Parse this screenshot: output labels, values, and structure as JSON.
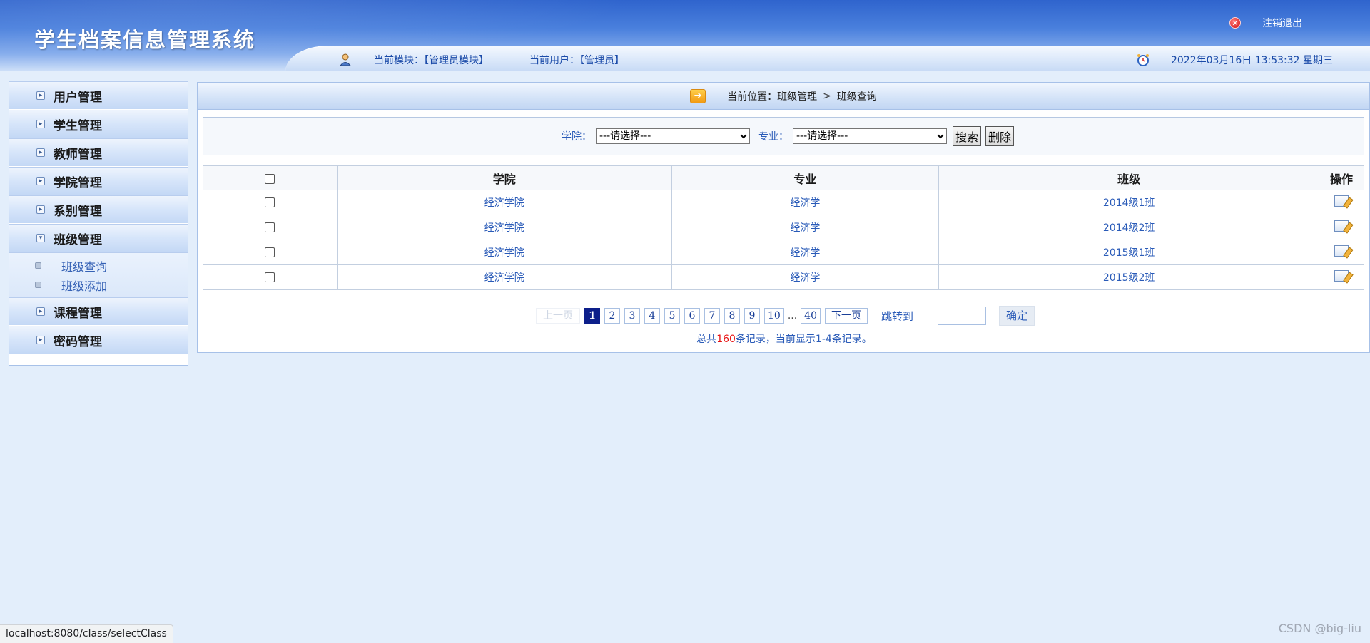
{
  "header": {
    "app_title": "学生档案信息管理系统",
    "logout_label": "注销退出",
    "current_module": "当前模块：【管理员模块】",
    "current_user": "当前用户：【管理员】",
    "datetime": "2022年03月16日 13:53:32 星期三"
  },
  "sidebar": {
    "items": [
      {
        "label": "用户管理"
      },
      {
        "label": "学生管理"
      },
      {
        "label": "教师管理"
      },
      {
        "label": "学院管理"
      },
      {
        "label": "系别管理"
      },
      {
        "label": "班级管理"
      },
      {
        "label": "课程管理"
      },
      {
        "label": "密码管理"
      }
    ],
    "sub_items": [
      {
        "label": "班级查询"
      },
      {
        "label": "班级添加"
      }
    ]
  },
  "breadcrumb": {
    "prefix": "当前位置：班级管理",
    "sep": ">",
    "current": "班级查询"
  },
  "filter": {
    "college_label": "学院：",
    "college_value": "---请选择---",
    "major_label": "专业：",
    "major_value": "---请选择---",
    "search_label": "搜索",
    "delete_label": "删除"
  },
  "table": {
    "headers": [
      "学院",
      "专业",
      "班级",
      "操作"
    ],
    "rows": [
      {
        "college": "经济学院",
        "major": "经济学",
        "class": "2014级1班"
      },
      {
        "college": "经济学院",
        "major": "经济学",
        "class": "2014级2班"
      },
      {
        "college": "经济学院",
        "major": "经济学",
        "class": "2015级1班"
      },
      {
        "college": "经济学院",
        "major": "经济学",
        "class": "2015级2班"
      }
    ]
  },
  "pager": {
    "prev": "上一页",
    "pages": [
      "1",
      "2",
      "3",
      "4",
      "5",
      "6",
      "7",
      "8",
      "9",
      "10"
    ],
    "ellipsis": "...",
    "last": "40",
    "next": "下一页",
    "jump_label": "跳转到",
    "ok": "确定",
    "summary_a": "总共",
    "summary_total": "160",
    "summary_b": "条记录，当前显示1-4条记录。"
  },
  "status_url": "localhost:8080/class/selectClass",
  "watermark": "CSDN @big-liu"
}
